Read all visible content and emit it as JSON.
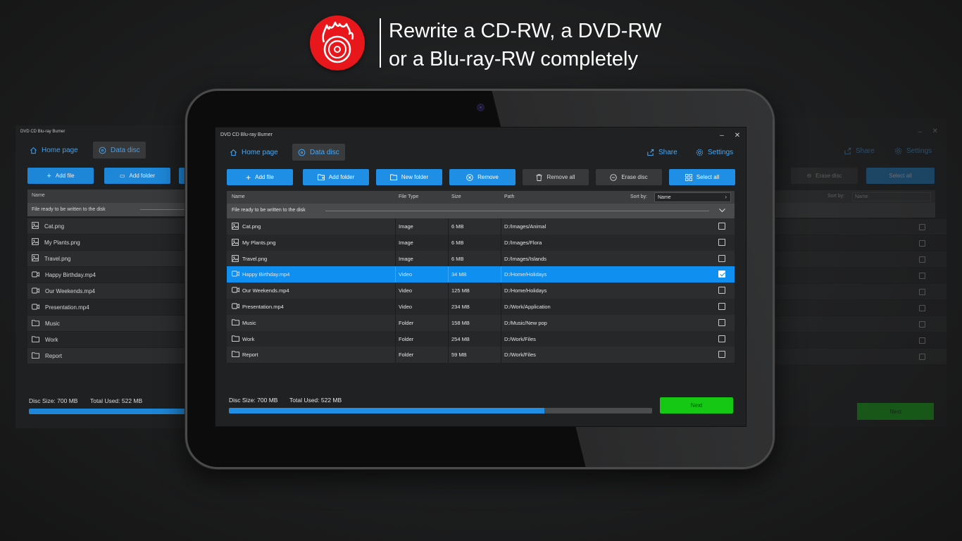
{
  "banner": {
    "line1": "Rewrite a CD-RW, a DVD-RW",
    "line2": "or a Blu-ray-RW completely"
  },
  "colors": {
    "accent": "#1f8fe6",
    "selected": "#0f8ff0",
    "next": "#14c814",
    "logo": "#e8171b"
  },
  "app": {
    "title": "DVD CD Blu-ray Burner",
    "nav": {
      "home": "Home page",
      "data_disc": "Data disc",
      "share": "Share",
      "settings": "Settings"
    },
    "toolbar": {
      "add_file": "Add file",
      "add_folder": "Add folder",
      "new_folder": "New folder",
      "remove": "Remove",
      "remove_all": "Remove all",
      "erase_disc": "Erase disc",
      "select_all": "Select all"
    },
    "table": {
      "columns": {
        "name": "Name",
        "type": "File Type",
        "size": "Size",
        "path": "Path"
      },
      "sort_by_label": "Sort by:",
      "sort_by_value": "Name",
      "group_label": "File ready to be written to the disk",
      "rows": [
        {
          "name": "Cat.png",
          "type": "Image",
          "size": "6 MB",
          "path": "D:/Images/Animal",
          "icon": "image-icon",
          "checked": false
        },
        {
          "name": "My Plants.png",
          "type": "Image",
          "size": "6 MB",
          "path": "D:/Images/Flora",
          "icon": "image-icon",
          "checked": false
        },
        {
          "name": "Travel.png",
          "type": "Image",
          "size": "6 MB",
          "path": "D:/Images/Islands",
          "icon": "image-icon",
          "checked": false
        },
        {
          "name": "Happy Birthday.mp4",
          "type": "Video",
          "size": "34 MB",
          "path": "D:/Home/Holidays",
          "icon": "video-icon",
          "checked": true
        },
        {
          "name": "Our Weekends.mp4",
          "type": "Video",
          "size": "125 MB",
          "path": "D:/Home/Holidays",
          "icon": "video-icon",
          "checked": false
        },
        {
          "name": "Presentation.mp4",
          "type": "Video",
          "size": "234 MB",
          "path": "D:/Work/Application",
          "icon": "video-icon",
          "checked": false
        },
        {
          "name": "Music",
          "type": "Folder",
          "size": "158 MB",
          "path": "D:/Music/New pop",
          "icon": "folder-icon",
          "checked": false
        },
        {
          "name": "Work",
          "type": "Folder",
          "size": "254 MB",
          "path": "D:/Work/Files",
          "icon": "folder-icon",
          "checked": false
        },
        {
          "name": "Report",
          "type": "Folder",
          "size": "59 MB",
          "path": "D:/Work/Files",
          "icon": "folder-icon",
          "checked": false
        }
      ]
    },
    "footer": {
      "disc_size": "Disc Size: 700 MB",
      "total_used": "Total Used: 522 MB",
      "used_fraction": 0.7457,
      "next": "Next"
    }
  }
}
